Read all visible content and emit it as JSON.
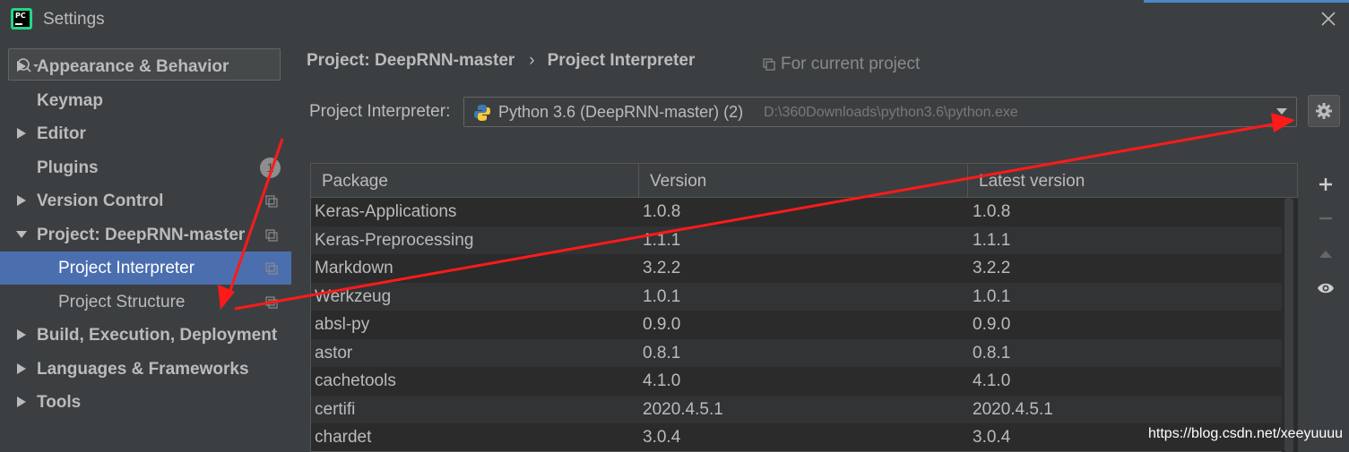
{
  "window": {
    "title": "Settings",
    "logo_text": "PC"
  },
  "sidebar": {
    "search_placeholder": "",
    "items": [
      {
        "label": "Appearance & Behavior",
        "expandable": true,
        "expanded": false
      },
      {
        "label": "Keymap",
        "expandable": false
      },
      {
        "label": "Editor",
        "expandable": true,
        "expanded": false
      },
      {
        "label": "Plugins",
        "expandable": false,
        "badge": "1"
      },
      {
        "label": "Version Control",
        "expandable": true,
        "expanded": false,
        "project_icon": true
      },
      {
        "label": "Project: DeepRNN-master",
        "expandable": true,
        "expanded": true,
        "project_icon": true
      },
      {
        "label": "Project Interpreter",
        "child": true,
        "selected": true,
        "project_icon": true
      },
      {
        "label": "Project Structure",
        "child": true,
        "project_icon": true
      },
      {
        "label": "Build, Execution, Deployment",
        "expandable": true,
        "expanded": false
      },
      {
        "label": "Languages & Frameworks",
        "expandable": true,
        "expanded": false
      },
      {
        "label": "Tools",
        "expandable": true,
        "expanded": false
      }
    ]
  },
  "header": {
    "breadcrumb": [
      "Project: DeepRNN-master",
      "Project Interpreter"
    ],
    "breadcrumb_sep": "›",
    "scope_label": "For current project"
  },
  "interpreter": {
    "label": "Project Interpreter:",
    "selected_name": "Python 3.6 (DeepRNN-master) (2)",
    "selected_path": "D:\\360Downloads\\python3.6\\python.exe"
  },
  "packages": {
    "columns": [
      "Package",
      "Version",
      "Latest version"
    ],
    "rows": [
      [
        "Keras-Applications",
        "1.0.8",
        "1.0.8"
      ],
      [
        "Keras-Preprocessing",
        "1.1.1",
        "1.1.1"
      ],
      [
        "Markdown",
        "3.2.2",
        "3.2.2"
      ],
      [
        "Werkzeug",
        "1.0.1",
        "1.0.1"
      ],
      [
        "absl-py",
        "0.9.0",
        "0.9.0"
      ],
      [
        "astor",
        "0.8.1",
        "0.8.1"
      ],
      [
        "cachetools",
        "4.1.0",
        "4.1.0"
      ],
      [
        "certifi",
        "2020.4.5.1",
        "2020.4.5.1"
      ],
      [
        "chardet",
        "3.0.4",
        "3.0.4"
      ]
    ]
  },
  "toolbar_icons": [
    "plus-icon",
    "minus-icon",
    "upgrade-icon",
    "eye-icon"
  ],
  "watermark": "https://blog.csdn.net/xeeyuuuu",
  "colors": {
    "selection": "#4b6eaf",
    "annotation": "#ff1a1a",
    "accent": "#4a88c7"
  }
}
